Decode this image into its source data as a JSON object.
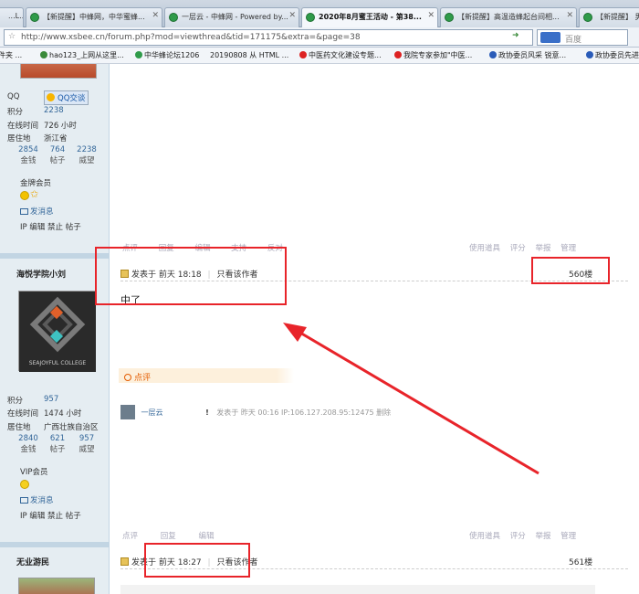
{
  "browser": {
    "tabs": [
      {
        "label": "...L...",
        "active": false
      },
      {
        "label": "【新提醒】中蜂网，中华蜜蜂...",
        "active": false
      },
      {
        "label": "一层云 - 中蜂网 - Powered by...",
        "active": false
      },
      {
        "label": "2020年8月蜜王活动 - 第38...",
        "active": true
      },
      {
        "label": "【新提醒】高温造蜂起台间相...",
        "active": false
      },
      {
        "label": "【新提醒】 男",
        "active": false
      }
    ],
    "url": "http://www.xsbee.cn/forum.php?mod=viewthread&tid=171175&extra=&page=38",
    "search_placeholder": "百度",
    "bookmarks": [
      "件夹 ...",
      "hao123_上网从这里...",
      "中华蜂论坛1206",
      "20190808 从 HTML ...",
      "中医药文化建设专题...",
      "我院专家参加\"中医...",
      "政协委员风采 锐意...",
      "政协委员先进"
    ]
  },
  "profile1": {
    "qq_label": "QQ",
    "qq_button": "QQ交谈",
    "jifen_label": "积分",
    "jifen_value": "2238",
    "online_label": "在线时间",
    "online_value": "726 小时",
    "location_label": "居住地",
    "location_value": "浙江省",
    "stats": [
      {
        "n": "2854",
        "l": "金钱"
      },
      {
        "n": "764",
        "l": "帖子"
      },
      {
        "n": "2238",
        "l": "威望"
      }
    ],
    "group": "金牌会员",
    "message_link": "发消息",
    "admin_links": "IP 编辑 禁止 帖子"
  },
  "post1_actions": {
    "left": [
      "点评",
      "回复",
      "编辑",
      "支持",
      "反对"
    ],
    "right": [
      "使用道具",
      "评分",
      "举报",
      "管理"
    ]
  },
  "post2": {
    "username": "海悦学院小刘",
    "avatar_text": "SEAJOYFUL COLLEGE",
    "posted": "发表于 前天 18:18",
    "only_author": "只看该作者",
    "floor": "560楼",
    "content": "中了",
    "dianping_label": "点评",
    "reply_user": "一层云",
    "reply_mark": "!",
    "reply_meta": "发表于 昨天 00:16 IP:106.127.208.95:12475 删除",
    "jifen_label": "积分",
    "jifen_value": "957",
    "online_label": "在线时间",
    "online_value": "1474 小时",
    "location_label": "居住地",
    "location_value": "广西壮族自治区",
    "stats": [
      {
        "n": "2840",
        "l": "金钱"
      },
      {
        "n": "621",
        "l": "帖子"
      },
      {
        "n": "957",
        "l": "威望"
      }
    ],
    "group": "VIP会员",
    "message_link": "发消息",
    "admin_links": "IP 编辑 禁止 帖子",
    "actions_left": [
      "点评",
      "回复",
      "编辑"
    ],
    "actions_right": [
      "使用道具",
      "评分",
      "举报",
      "管理"
    ]
  },
  "post3": {
    "username": "无业游民",
    "posted": "发表于 前天 18:27",
    "only_author": "只看该作者",
    "floor": "561楼"
  },
  "colors": {
    "annotation_red": "#e8242a",
    "sidebar_bg": "#e5edf2",
    "link_blue": "#336699"
  }
}
